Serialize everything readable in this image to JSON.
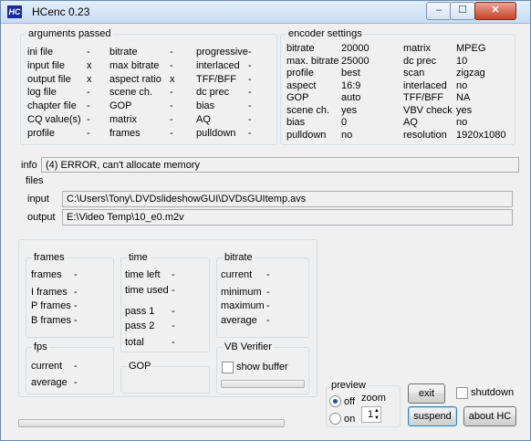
{
  "window": {
    "title": "HCenc 0.23",
    "icon": "HC",
    "minimize": "–",
    "maximize": "☐",
    "close": "✕"
  },
  "args": {
    "title": "arguments passed",
    "rows": [
      [
        {
          "label": "ini file",
          "value": "-"
        },
        {
          "label": "bitrate",
          "value": "-"
        },
        {
          "label": "progressive",
          "value": "-"
        }
      ],
      [
        {
          "label": "input file",
          "value": "x"
        },
        {
          "label": "max bitrate",
          "value": "-"
        },
        {
          "label": "interlaced",
          "value": "-"
        }
      ],
      [
        {
          "label": "output file",
          "value": "x"
        },
        {
          "label": "aspect ratio",
          "value": "x"
        },
        {
          "label": "TFF/BFF",
          "value": "-"
        }
      ],
      [
        {
          "label": "log file",
          "value": "-"
        },
        {
          "label": "scene ch.",
          "value": "-"
        },
        {
          "label": "dc prec",
          "value": "-"
        }
      ],
      [
        {
          "label": "chapter file",
          "value": "-"
        },
        {
          "label": "GOP",
          "value": "-"
        },
        {
          "label": "bias",
          "value": "-"
        }
      ],
      [
        {
          "label": "CQ value(s)",
          "value": "-"
        },
        {
          "label": "matrix",
          "value": "-"
        },
        {
          "label": "AQ",
          "value": "-"
        }
      ],
      [
        {
          "label": "profile",
          "value": "-"
        },
        {
          "label": "frames",
          "value": "-"
        },
        {
          "label": "pulldown",
          "value": "-"
        }
      ]
    ]
  },
  "encoder": {
    "title": "encoder settings",
    "rows": [
      [
        {
          "label": "bitrate",
          "value": "20000"
        },
        {
          "label": "matrix",
          "value": "MPEG"
        }
      ],
      [
        {
          "label": "max. bitrate",
          "value": "25000"
        },
        {
          "label": "dc prec",
          "value": "10"
        }
      ],
      [
        {
          "label": "profile",
          "value": "best"
        },
        {
          "label": "scan",
          "value": "zigzag"
        }
      ],
      [
        {
          "label": "aspect",
          "value": "16:9"
        },
        {
          "label": "interlaced",
          "value": "no"
        }
      ],
      [
        {
          "label": "GOP",
          "value": "auto"
        },
        {
          "label": "TFF/BFF",
          "value": "NA"
        }
      ],
      [
        {
          "label": "scene ch.",
          "value": "yes"
        },
        {
          "label": "VBV check",
          "value": "yes"
        }
      ],
      [
        {
          "label": "bias",
          "value": "0"
        },
        {
          "label": "AQ",
          "value": "no"
        }
      ],
      [
        {
          "label": "pulldown",
          "value": "no"
        },
        {
          "label": "resolution",
          "value": "1920x1080"
        }
      ]
    ]
  },
  "info": {
    "label": "info",
    "value": "(4) ERROR, can't allocate memory"
  },
  "files": {
    "title": "files",
    "input_label": "input",
    "input_value": "C:\\Users\\Tony\\.DVDslideshowGUI\\DVDsGUItemp.avs",
    "output_label": "output",
    "output_value": "E:\\Video Temp\\10_e0.m2v"
  },
  "frames": {
    "title": "frames",
    "rows": [
      {
        "label": "frames",
        "value": "-"
      },
      {
        "label": "I frames",
        "value": "-"
      },
      {
        "label": "P frames",
        "value": "-"
      },
      {
        "label": "B frames",
        "value": "-"
      }
    ]
  },
  "fps": {
    "title": "fps",
    "rows": [
      {
        "label": "current",
        "value": "-"
      },
      {
        "label": "average",
        "value": "-"
      }
    ]
  },
  "time": {
    "title": "time",
    "rows": [
      {
        "label": "time left",
        "value": "-"
      },
      {
        "label": "time used",
        "value": "-"
      },
      {
        "label": "pass 1",
        "value": "-"
      },
      {
        "label": "pass 2",
        "value": "-"
      },
      {
        "label": "total",
        "value": "-"
      }
    ]
  },
  "gop": {
    "title": "GOP"
  },
  "bitrate": {
    "title": "bitrate",
    "rows": [
      {
        "label": "current",
        "value": "-"
      },
      {
        "label": "minimum",
        "value": "-"
      },
      {
        "label": "maximum",
        "value": "-"
      },
      {
        "label": "average",
        "value": "-"
      }
    ]
  },
  "vb": {
    "title": "VB Verifier",
    "show_buffer_label": "show buffer",
    "show_buffer_checked": false,
    "progress": 0
  },
  "preview": {
    "title": "preview",
    "off_label": "off",
    "on_label": "on",
    "selected": "off",
    "zoom_label": "zoom",
    "zoom_value": "1"
  },
  "buttons": {
    "exit": "exit",
    "shutdown_label": "shutdown",
    "shutdown_checked": false,
    "suspend": "suspend",
    "about": "about HC"
  },
  "main_progress": 0
}
